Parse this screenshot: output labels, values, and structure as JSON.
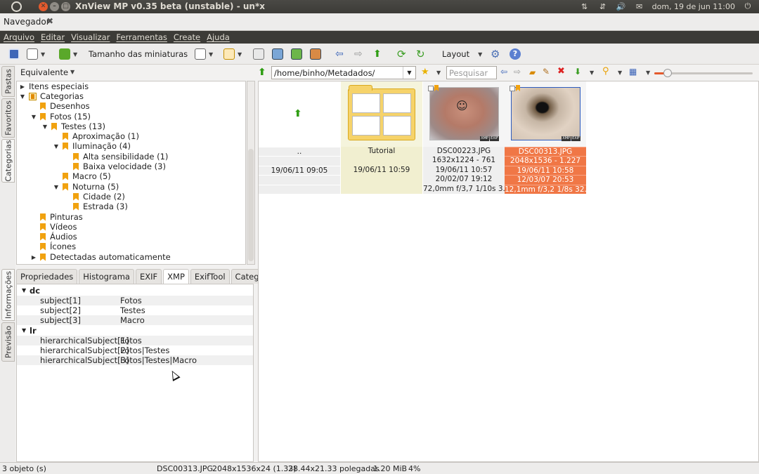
{
  "window": {
    "title": "XnView MP v0.35 beta (unstable) - un*x",
    "close_glyph": "✕",
    "min_glyph": "–",
    "max_glyph": "□"
  },
  "tray": {
    "datetime": "dom, 19 de jun 11:00",
    "icons": [
      "network-icon",
      "transfer-icon",
      "volume-icon",
      "mail-icon",
      "power-icon"
    ]
  },
  "navigator_tab": {
    "label": "Navegador",
    "close_glyph": "✖"
  },
  "menu": {
    "items": [
      "Arquivo",
      "Editar",
      "Visualizar",
      "Ferramentas",
      "Create",
      "Ajuda"
    ]
  },
  "toolbar": {
    "thumb_size_label": "Tamanho das miniaturas",
    "layout_label": "Layout"
  },
  "side_tabs": {
    "top": [
      "Pastas",
      "Favoritos",
      "Categorias"
    ],
    "bottom": [
      "Informações",
      "Previsão"
    ]
  },
  "tree": {
    "header": "Equivalente",
    "nodes": [
      {
        "label": "Itens especiais",
        "arrow": "▶",
        "icon": "none"
      },
      {
        "label": "Categorias",
        "arrow": "▼",
        "icon": "box"
      },
      {
        "label": "Desenhos",
        "arrow": "",
        "icon": "bookmark"
      },
      {
        "label": "Fotos (15)",
        "arrow": "▼",
        "icon": "bookmark"
      },
      {
        "label": "Testes (13)",
        "arrow": "▼",
        "icon": "bookmark"
      },
      {
        "label": "Aproximação (1)",
        "arrow": "",
        "icon": "bookmark"
      },
      {
        "label": "Iluminação (4)",
        "arrow": "▼",
        "icon": "bookmark"
      },
      {
        "label": "Alta sensibilidade (1)",
        "arrow": "",
        "icon": "bookmark"
      },
      {
        "label": "Baixa velocidade (3)",
        "arrow": "",
        "icon": "bookmark"
      },
      {
        "label": "Macro (5)",
        "arrow": "",
        "icon": "bookmark"
      },
      {
        "label": "Noturna (5)",
        "arrow": "▼",
        "icon": "bookmark"
      },
      {
        "label": "Cidade (2)",
        "arrow": "",
        "icon": "bookmark"
      },
      {
        "label": "Estrada (3)",
        "arrow": "",
        "icon": "bookmark"
      },
      {
        "label": "Pinturas",
        "arrow": "",
        "icon": "bookmark"
      },
      {
        "label": "Vídeos",
        "arrow": "",
        "icon": "bookmark"
      },
      {
        "label": "Áudios",
        "arrow": "",
        "icon": "bookmark"
      },
      {
        "label": "Ícones",
        "arrow": "",
        "icon": "bookmark"
      },
      {
        "label": "Detectadas automaticamente",
        "arrow": "▶",
        "icon": "bookmark"
      }
    ]
  },
  "info_tabs": [
    "Propriedades",
    "Histograma",
    "EXIF",
    "XMP",
    "ExifTool",
    "Categorias"
  ],
  "xmp": {
    "groups": [
      {
        "name": "dc",
        "rows": [
          {
            "key": "subject[1]",
            "value": "Fotos"
          },
          {
            "key": "subject[2]",
            "value": "Testes"
          },
          {
            "key": "subject[3]",
            "value": "Macro"
          }
        ]
      },
      {
        "name": "lr",
        "rows": [
          {
            "key": "hierarchicalSubject[1]",
            "value": "Fotos"
          },
          {
            "key": "hierarchicalSubject[2]",
            "value": "Fotos|Testes"
          },
          {
            "key": "hierarchicalSubject[3]",
            "value": "Fotos|Testes|Macro"
          }
        ]
      }
    ]
  },
  "address": {
    "path": "/home/binho/Metadados/",
    "search_placeholder": "Pesquisar"
  },
  "browser": {
    "items": [
      {
        "kind": "parent",
        "name": "..",
        "lines": [
          "..",
          "",
          "19/06/11 09:05",
          "",
          ""
        ]
      },
      {
        "kind": "folder",
        "name": "Tutorial",
        "lines": [
          "Tutorial",
          "",
          "19/06/11 10:59",
          "",
          ""
        ]
      },
      {
        "kind": "pic",
        "name": "DSC00223.JPG",
        "lines": [
          "DSC00223.JPG",
          "1632x1224 - 761",
          "19/06/11 10:57",
          "20/02/07 19:12",
          "72,0mm f/3,7 1/10s 3..."
        ]
      },
      {
        "kind": "selected",
        "name": "DSC00313.JPG",
        "lines": [
          "DSC00313.JPG",
          "2048x1536 - 1.227",
          "19/06/11 10:58",
          "12/03/07 20:53",
          "12,1mm f/3,2 1/8s 32..."
        ]
      }
    ],
    "badges": [
      "XMP",
      "EXIF"
    ]
  },
  "status": {
    "count": "3 objeto (s)",
    "file": "DSC00313.JPG",
    "dims": "2048x1536x24 (1.33)",
    "size_inches": "28.44x21.33 polegadas",
    "filesize": "1.20 MiB",
    "zoom": "4%"
  },
  "colors": {
    "accent": "#f07746",
    "menubar": "#3c3b37",
    "bookmark": "#f1a20f"
  }
}
